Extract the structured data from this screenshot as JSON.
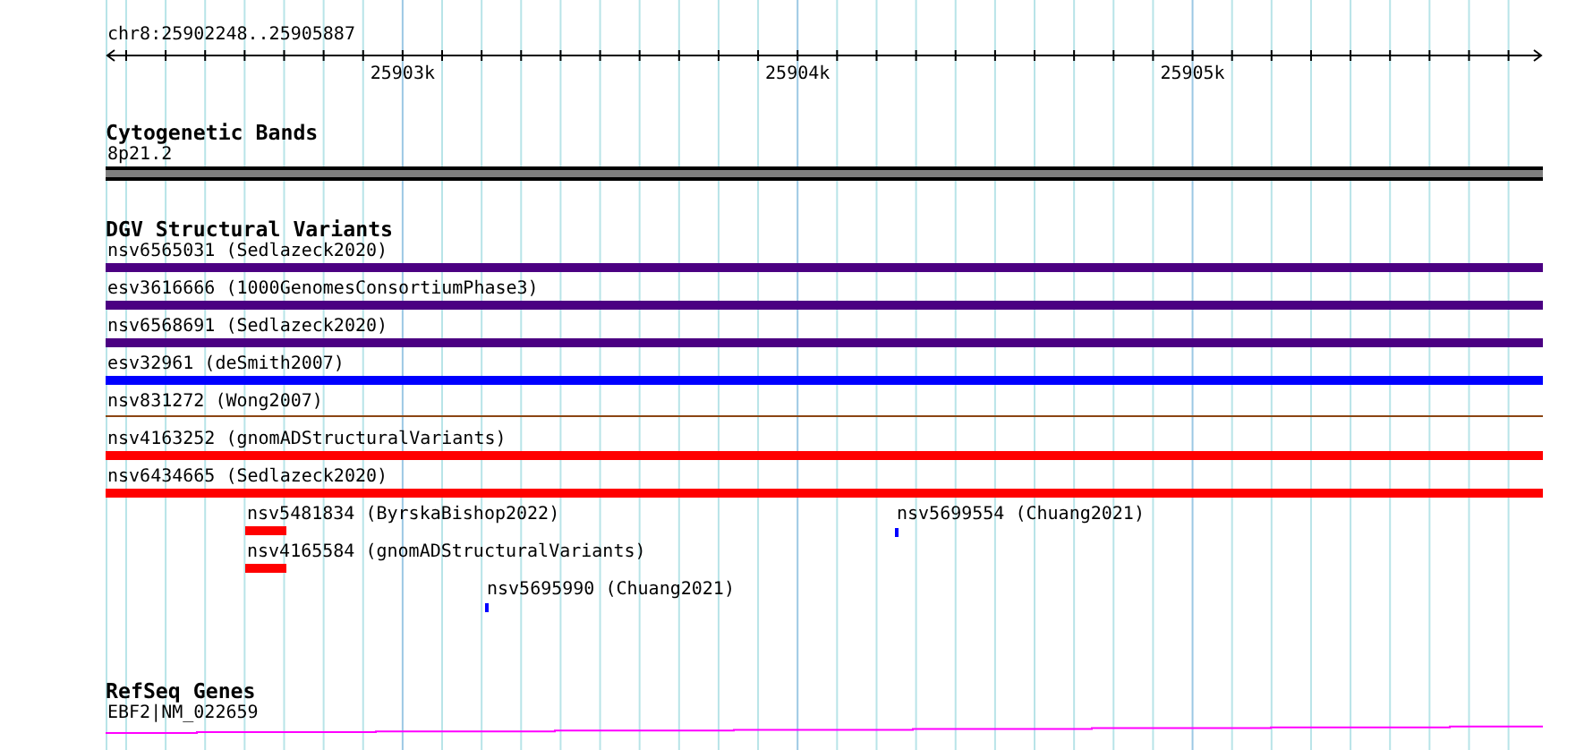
{
  "ruler": {
    "position": "chr8:25902248..25905887",
    "tick_labels": [
      "25903k",
      "25904k",
      "25905k"
    ]
  },
  "cytogenetic_bands": {
    "title": "Cytogenetic Bands",
    "band": "8p21.2"
  },
  "dgv_structural_variants": {
    "title": "DGV Structural Variants",
    "variants": [
      {
        "label": "nsv6565031 (Sedlazeck2020)",
        "kind": "bar",
        "color": "#4b0082"
      },
      {
        "label": "esv3616666 (1000GenomesConsortiumPhase3)",
        "kind": "bar",
        "color": "#4b0082"
      },
      {
        "label": "nsv6568691 (Sedlazeck2020)",
        "kind": "bar",
        "color": "#4b0082"
      },
      {
        "label": "esv32961 (deSmith2007)",
        "kind": "bar",
        "color": "#0000ff"
      },
      {
        "label": "nsv831272 (Wong2007)",
        "kind": "line",
        "color": "#8b4513"
      },
      {
        "label": "nsv4163252 (gnomADStructuralVariants)",
        "kind": "bar",
        "color": "#ff0000"
      },
      {
        "label": "nsv6434665 (Sedlazeck2020)",
        "kind": "bar",
        "color": "#ff0000"
      }
    ],
    "short_variants": [
      {
        "label": "nsv5481834 (ByrskaBishop2022)",
        "kind": "block",
        "color": "#ff0000"
      },
      {
        "label": "nsv5699554 (Chuang2021)",
        "kind": "tick",
        "color": "#0000ff"
      },
      {
        "label": "nsv4165584 (gnomADStructuralVariants)",
        "kind": "block",
        "color": "#ff0000"
      },
      {
        "label": "nsv5695990 (Chuang2021)",
        "kind": "tick",
        "color": "#0000ff"
      }
    ]
  },
  "refseq_genes": {
    "title": "RefSeq Genes",
    "gene": "EBF2|NM_022659"
  }
}
